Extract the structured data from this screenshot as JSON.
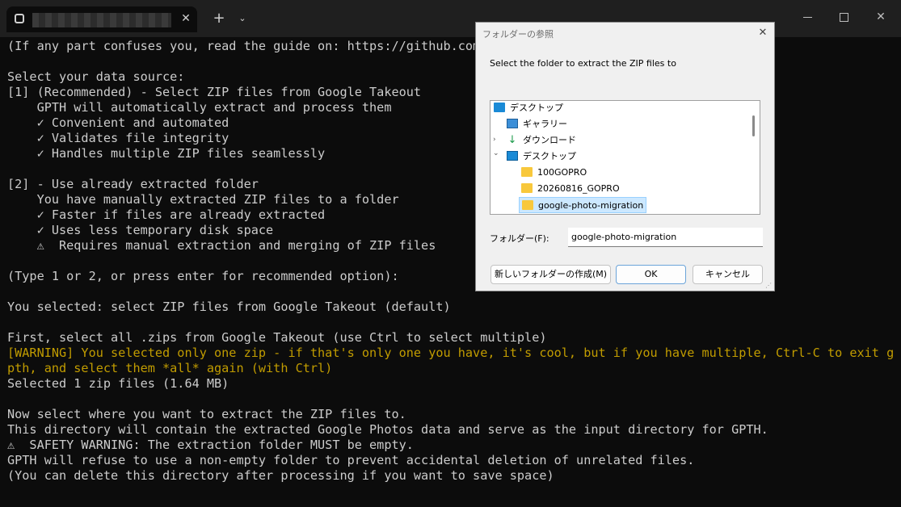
{
  "window": {
    "tab_title": "████████████",
    "tab_close": "✕",
    "new_tab": "+",
    "tab_dropdown": "⌄",
    "close": "✕"
  },
  "terminal": {
    "lines": [
      {
        "text": "(If any part confuses you, read the guide on: https://github.com/",
        "style": "normal"
      },
      {
        "text": "",
        "style": "normal"
      },
      {
        "text": "Select your data source:",
        "style": "normal"
      },
      {
        "text": "[1] (Recommended) - Select ZIP files from Google Takeout",
        "style": "normal"
      },
      {
        "text": "    GPTH will automatically extract and process them",
        "style": "normal"
      },
      {
        "text": "    ✓ Convenient and automated",
        "style": "normal"
      },
      {
        "text": "    ✓ Validates file integrity",
        "style": "normal"
      },
      {
        "text": "    ✓ Handles multiple ZIP files seamlessly",
        "style": "normal"
      },
      {
        "text": "",
        "style": "normal"
      },
      {
        "text": "[2] - Use already extracted folder",
        "style": "normal"
      },
      {
        "text": "    You have manually extracted ZIP files to a folder",
        "style": "normal"
      },
      {
        "text": "    ✓ Faster if files are already extracted",
        "style": "normal"
      },
      {
        "text": "    ✓ Uses less temporary disk space",
        "style": "normal"
      },
      {
        "text": "    ⚠  Requires manual extraction and merging of ZIP files",
        "style": "normal"
      },
      {
        "text": "",
        "style": "normal"
      },
      {
        "text": "(Type 1 or 2, or press enter for recommended option):",
        "style": "normal"
      },
      {
        "text": "",
        "style": "normal"
      },
      {
        "text": "You selected: select ZIP files from Google Takeout (default)",
        "style": "normal"
      },
      {
        "text": "",
        "style": "normal"
      },
      {
        "text": "First, select all .zips from Google Takeout (use Ctrl to select multiple)",
        "style": "normal"
      },
      {
        "text": "[WARNING] You selected only one zip - if that's only one you have, it's cool, but if you have multiple, Ctrl-C to exit g",
        "style": "warn"
      },
      {
        "text": "pth, and select them *all* again (with Ctrl)",
        "style": "warn"
      },
      {
        "text": "Selected 1 zip files (1.64 MB)",
        "style": "normal"
      },
      {
        "text": "",
        "style": "normal"
      },
      {
        "text": "Now select where you want to extract the ZIP files to.",
        "style": "normal"
      },
      {
        "text": "This directory will contain the extracted Google Photos data and serve as the input directory for GPTH.",
        "style": "normal"
      },
      {
        "text": "⚠  SAFETY WARNING: The extraction folder MUST be empty.",
        "style": "normal"
      },
      {
        "text": "GPTH will refuse to use a non-empty folder to prevent accidental deletion of unrelated files.",
        "style": "normal"
      },
      {
        "text": "(You can delete this directory after processing if you want to save space)",
        "style": "normal"
      }
    ]
  },
  "dialog": {
    "title": "フォルダーの参照",
    "close": "✕",
    "description": "Select the folder to extract the ZIP files to",
    "tree": [
      {
        "label": "デスクトップ",
        "icon": "desktop-icon"
      },
      {
        "label": "ギャラリー",
        "icon": "gallery-icon"
      },
      {
        "label": "ダウンロード",
        "icon": "download-icon",
        "arrow": "›"
      },
      {
        "label": "デスクトップ",
        "icon": "desktop-icon",
        "arrow": "⌄"
      },
      {
        "label": "100GOPRO",
        "icon": "folder-icon"
      },
      {
        "label": "20260816_GOPRO",
        "icon": "folder-icon"
      },
      {
        "label": "google-photo-migration",
        "icon": "folder-icon",
        "selected": true
      }
    ],
    "folder_label": "フォルダー(F):",
    "folder_value": "google-photo-migration",
    "new_folder_button": "新しいフォルダーの作成(M)",
    "ok_button": "OK",
    "cancel_button": "キャンセル"
  }
}
